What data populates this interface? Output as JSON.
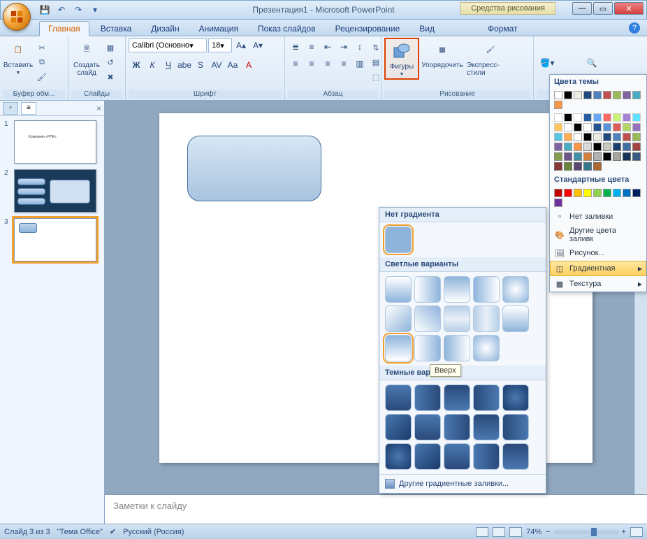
{
  "title": "Презентация1 - Microsoft PowerPoint",
  "contextual_tab": "Средства рисования",
  "tabs": {
    "home": "Главная",
    "insert": "Вставка",
    "design": "Дизайн",
    "animation": "Анимация",
    "slideshow": "Показ слайдов",
    "review": "Рецензирование",
    "view": "Вид",
    "format": "Формат"
  },
  "ribbon": {
    "clipboard": {
      "label": "Буфер обм...",
      "paste": "Вставить"
    },
    "slides": {
      "label": "Слайды",
      "new_slide": "Создать\nслайд"
    },
    "font": {
      "label": "Шрифт",
      "name": "Calibri (Основно",
      "size": "18"
    },
    "paragraph": {
      "label": "Абзац"
    },
    "drawing": {
      "label": "Рисование",
      "shapes": "Фигуры",
      "arrange": "Упорядочить",
      "quick": "Экспресс-стили"
    }
  },
  "color_panel": {
    "theme_colors": "Цвета темы",
    "standard_colors": "Стандартные цвета",
    "no_fill": "Нет заливки",
    "more_colors": "Другие цвета заливк",
    "picture": "Рисунок...",
    "gradient": "Градиентная",
    "texture": "Текстура",
    "theme_row1": [
      "#ffffff",
      "#000000",
      "#eeece1",
      "#1f497d",
      "#4f81bd",
      "#c0504d",
      "#9bbb59",
      "#8064a2",
      "#4bacc6",
      "#f79646"
    ],
    "standard_row": [
      "#c00000",
      "#ff0000",
      "#ffc000",
      "#ffff00",
      "#92d050",
      "#00b050",
      "#00b0f0",
      "#0070c0",
      "#002060",
      "#7030a0"
    ]
  },
  "gradient_popup": {
    "no_gradient": "Нет градиента",
    "light": "Светлые варианты",
    "dark": "Темные вар",
    "more": "Другие градиентные заливки...",
    "tooltip": "Вверх"
  },
  "slide_panel": {
    "numbers": [
      "1",
      "2",
      "3"
    ]
  },
  "notes": {
    "placeholder": "Заметки к слайду"
  },
  "status": {
    "slide_info": "Слайд 3 из 3",
    "theme": "\"Тема Office\"",
    "language": "Русский (Россия)",
    "zoom": "74%"
  }
}
